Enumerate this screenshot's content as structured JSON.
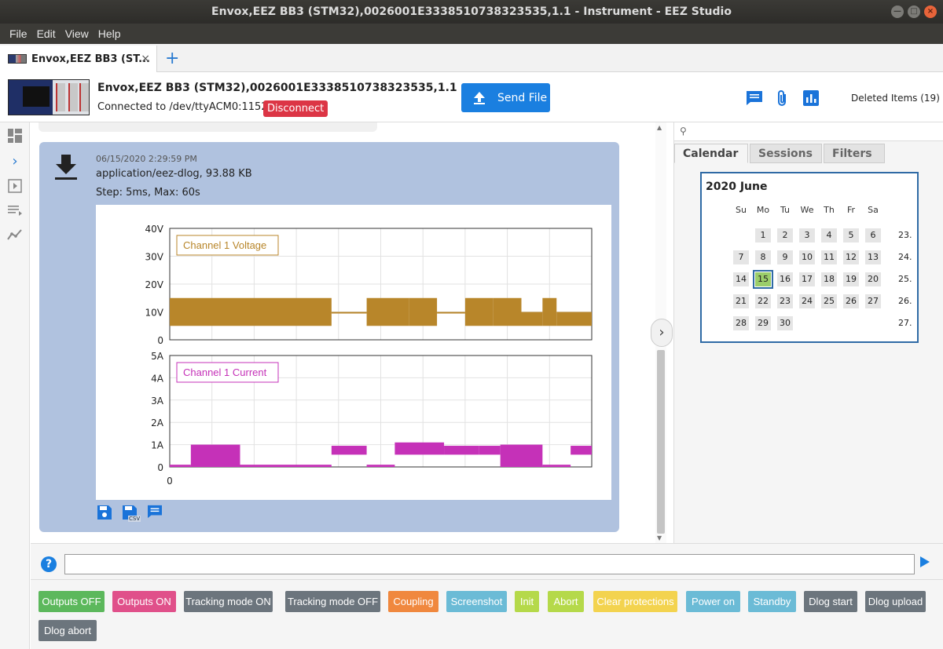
{
  "window": {
    "title": "Envox,EEZ BB3 (STM32),0026001E3338510738323535,1.1 - Instrument - EEZ Studio",
    "controls": [
      "—",
      "□",
      "×"
    ]
  },
  "menu": [
    "File",
    "Edit",
    "View",
    "Help"
  ],
  "tab": {
    "label": "Envox,EEZ BB3 (ST...",
    "close": "×",
    "add": "+"
  },
  "header": {
    "instrument_name": "Envox,EEZ BB3 (STM32),0026001E3338510738323535,1.1",
    "connection": "Connected to /dev/ttyACM0:115200",
    "disconnect": "Disconnect",
    "send_file": "Send File",
    "deleted_items": "Deleted Items (19)",
    "icons": [
      "comment-icon",
      "attachment-icon",
      "chart-icon"
    ]
  },
  "message": {
    "date": "06/15/2020 2:29:59 PM",
    "type": "application/eez-dlog, 93.88 KB",
    "step": "Step: 5ms, Max: 60s",
    "tools": [
      "save-icon",
      "save-csv-icon",
      "comment-icon"
    ],
    "csv_label": "CSV"
  },
  "chart_data": [
    {
      "type": "line",
      "title": "Channel 1 Voltage",
      "ylabel": "",
      "ylim": [
        0,
        40
      ],
      "y_ticks": [
        "40V",
        "30V",
        "20V",
        "10V",
        "0"
      ],
      "xlim": [
        0,
        60
      ],
      "x_ticks": [
        "0"
      ],
      "color": "#b8862a",
      "series": [
        {
          "name": "Channel 1 Voltage",
          "bands": [
            {
              "from": 0,
              "to": 23,
              "low": 5,
              "high": 15
            },
            {
              "from": 23,
              "to": 28,
              "low": 10,
              "high": 10
            },
            {
              "from": 28,
              "to": 34,
              "low": 5,
              "high": 15
            },
            {
              "from": 34,
              "to": 38,
              "low": 5,
              "high": 15
            },
            {
              "from": 38,
              "to": 42,
              "low": 10,
              "high": 10
            },
            {
              "from": 42,
              "to": 46,
              "low": 5,
              "high": 15
            },
            {
              "from": 46,
              "to": 50,
              "low": 5,
              "high": 15
            },
            {
              "from": 50,
              "to": 53,
              "low": 5,
              "high": 10
            },
            {
              "from": 53,
              "to": 55,
              "low": 5,
              "high": 15
            },
            {
              "from": 55,
              "to": 60,
              "low": 5,
              "high": 10
            }
          ]
        }
      ]
    },
    {
      "type": "line",
      "title": "Channel 1 Current",
      "ylabel": "",
      "ylim": [
        0,
        5
      ],
      "y_ticks": [
        "5A",
        "4A",
        "3A",
        "2A",
        "1A",
        "0"
      ],
      "xlim": [
        0,
        60
      ],
      "x_ticks": [
        "0"
      ],
      "color": "#c531b8",
      "series": [
        {
          "name": "Channel 1 Current",
          "bands": [
            {
              "from": 0,
              "to": 3,
              "low": 0,
              "high": 0.1
            },
            {
              "from": 3,
              "to": 10,
              "low": 0,
              "high": 1.0
            },
            {
              "from": 10,
              "to": 23,
              "low": 0,
              "high": 0.1
            },
            {
              "from": 23,
              "to": 28,
              "low": 0.55,
              "high": 0.95
            },
            {
              "from": 28,
              "to": 32,
              "low": 0,
              "high": 0.1
            },
            {
              "from": 32,
              "to": 39,
              "low": 0.55,
              "high": 1.1
            },
            {
              "from": 39,
              "to": 44,
              "low": 0.55,
              "high": 0.95
            },
            {
              "from": 44,
              "to": 47,
              "low": 0.55,
              "high": 0.95
            },
            {
              "from": 47,
              "to": 53,
              "low": 0,
              "high": 1.0
            },
            {
              "from": 53,
              "to": 57,
              "low": 0,
              "high": 0.1
            },
            {
              "from": 57,
              "to": 60,
              "low": 0.55,
              "high": 0.95
            }
          ]
        }
      ]
    }
  ],
  "right_panel": {
    "search_placeholder": "",
    "tabs": [
      "Calendar",
      "Sessions",
      "Filters"
    ],
    "calendar": {
      "title": "2020 June",
      "weekdays": [
        "Su",
        "Mo",
        "Tu",
        "We",
        "Th",
        "Fr",
        "Sa"
      ],
      "selected_day": 15,
      "weeks": [
        {
          "days": [
            "",
            "1",
            "2",
            "3",
            "4",
            "5",
            "6"
          ],
          "week": "23."
        },
        {
          "days": [
            "7",
            "8",
            "9",
            "10",
            "11",
            "12",
            "13"
          ],
          "week": "24."
        },
        {
          "days": [
            "14",
            "15",
            "16",
            "17",
            "18",
            "19",
            "20"
          ],
          "week": "25."
        },
        {
          "days": [
            "21",
            "22",
            "23",
            "24",
            "25",
            "26",
            "27"
          ],
          "week": "26."
        },
        {
          "days": [
            "28",
            "29",
            "30",
            "",
            "",
            "",
            ""
          ],
          "week": "27."
        }
      ]
    }
  },
  "command_input": {
    "value": "",
    "placeholder": "",
    "help": "?"
  },
  "shortcuts": [
    {
      "label": "Outputs OFF",
      "color": "#5cb85c"
    },
    {
      "label": "Outputs ON",
      "color": "#e0508a"
    },
    {
      "label": "Tracking mode ON",
      "color": "#6c757d"
    },
    {
      "label": "Tracking mode OFF",
      "color": "#6c757d"
    },
    {
      "label": "Coupling",
      "color": "#f0883e"
    },
    {
      "label": "Screenshot",
      "color": "#6bbbd6"
    },
    {
      "label": "Init",
      "color": "#b5d94a"
    },
    {
      "label": "Abort",
      "color": "#b5d94a"
    },
    {
      "label": "Clear protections",
      "color": "#f3d34f"
    },
    {
      "label": "Power on",
      "color": "#6bbbd6"
    },
    {
      "label": "Standby",
      "color": "#6bbbd6"
    },
    {
      "label": "Dlog start",
      "color": "#6c757d"
    },
    {
      "label": "Dlog upload",
      "color": "#6c757d"
    },
    {
      "label": "Dlog abort",
      "color": "#6c757d"
    }
  ]
}
